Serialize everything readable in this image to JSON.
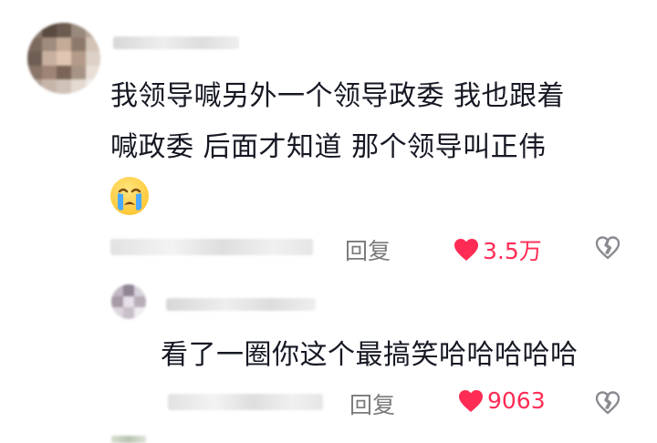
{
  "comments": [
    {
      "text_line1": "我领导喊另外一个领导政委 我也跟着",
      "text_line2": "喊政委 后面才知道 那个领导叫正伟",
      "emoji": "crying-face-emoji",
      "reply_label": "回复",
      "like_count": "3.5万"
    }
  ],
  "replies": [
    {
      "text": "看了一圈你这个最搞笑哈哈哈哈哈",
      "reply_label": "回复",
      "like_count": "9063"
    }
  ],
  "colors": {
    "like_red": "#fe2c55",
    "text": "#161823",
    "secondary": "#7a7a7a"
  }
}
